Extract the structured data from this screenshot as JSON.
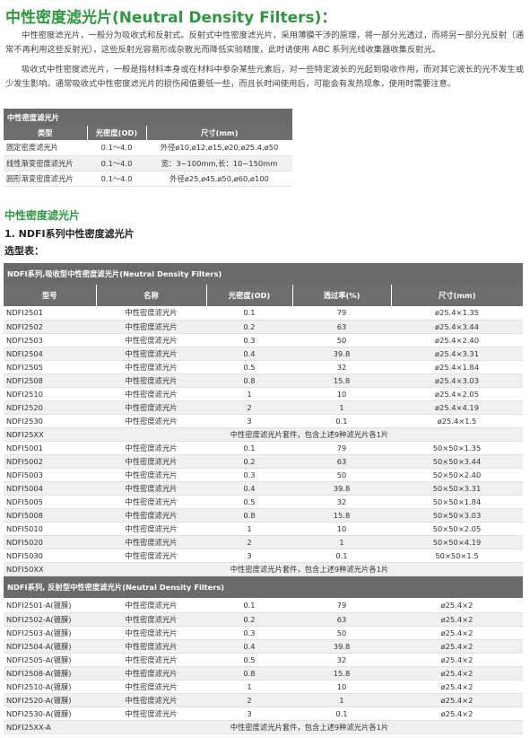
{
  "title": "中性密度滤光片(Neutral Density Filters)：",
  "intro_p1": "中性密度滤光片，一般分为吸收式和反射式。反射式中性密度滤光片，采用薄膜干涉的原理，将一部分光透过，而将另一部分光反射（通常不再利用这些反射光），这些反射光容易形成杂散光而降低实验精度，此时请使用 ABC 系列光线收集器收集反射光。",
  "intro_p2": "吸收式中性密度滤光片，一般是指材料本身或在材料中参杂某些元素后，对一些特定波长的光起到吸收作用，而对其它波长的光不发生或少发生影响。通常吸收式中性密度滤光片的损伤阈值要低一些，而且长时间使用后，可能会有发热现象，使用时需要注意。",
  "summary_table": {
    "caption": "中性密度滤光片",
    "headers": [
      "类型",
      "光密度(OD)",
      "尺寸(mm)"
    ],
    "rows": [
      [
        "固定密度滤光片",
        "0.1～4.0",
        "外径ø10,ø12,ø15,ø20,ø25.4,ø50"
      ],
      [
        "线性渐变密度滤光片",
        "0.1～4.0",
        "宽：3~100mm,长：10~150mm"
      ],
      [
        "圆形渐变密度滤光片",
        "0.1～4.0",
        "外径ø25,ø45,ø50,ø60,ø100"
      ]
    ]
  },
  "section_heading": "中性密度滤光片",
  "sub_heading": "1. NDFI系列中性密度滤光片",
  "selection_label": "选型表：",
  "absorptive_table": {
    "caption": "NDFI系列,吸收型中性密度滤光片(Neutral Density Filters)",
    "headers": [
      "型号",
      "名称",
      "光密度(OD)",
      "透过率(%)",
      "尺寸(mm)"
    ],
    "rows": [
      [
        "NDFI2501",
        "中性密度滤光片",
        "0.1",
        "79",
        "ø25.4×1.35"
      ],
      [
        "NDFI2502",
        "中性密度滤光片",
        "0.2",
        "63",
        "ø25.4×3.44"
      ],
      [
        "NDFI2503",
        "中性密度滤光片",
        "0.3",
        "50",
        "ø25.4×2.40"
      ],
      [
        "NDFI2504",
        "中性密度滤光片",
        "0.4",
        "39.8",
        "ø25.4×3.31"
      ],
      [
        "NDFI2505",
        "中性密度滤光片",
        "0.5",
        "32",
        "ø25.4×1.84"
      ],
      [
        "NDFI2508",
        "中性密度滤光片",
        "0.8",
        "15.8",
        "ø25.4×3.03"
      ],
      [
        "NDFI2510",
        "中性密度滤光片",
        "1",
        "10",
        "ø25.4×2.05"
      ],
      [
        "NDFI2520",
        "中性密度滤光片",
        "2",
        "1",
        "ø25.4×4.19"
      ],
      [
        "NDFI2530",
        "中性密度滤光片",
        "3",
        "0.1",
        "ø25.4×1.5"
      ],
      [
        "NDFI25XX",
        "中性密度滤光片套件，包含上述9种滤光片各1片"
      ],
      [
        "NDFI5001",
        "中性密度滤光片",
        "0.1",
        "79",
        "50×50×1.35"
      ],
      [
        "NDFI5002",
        "中性密度滤光片",
        "0.2",
        "63",
        "50×50×3.44"
      ],
      [
        "NDFI5003",
        "中性密度滤光片",
        "0.3",
        "50",
        "50×50×2.40"
      ],
      [
        "NDFI5004",
        "中性密度滤光片",
        "0.4",
        "39.8",
        "50×50×3.31"
      ],
      [
        "NDFI5005",
        "中性密度滤光片",
        "0.5",
        "32",
        "50×50×1.84"
      ],
      [
        "NDFI5008",
        "中性密度滤光片",
        "0.8",
        "15.8",
        "50×50×3.03"
      ],
      [
        "NDFI5010",
        "中性密度滤光片",
        "1",
        "10",
        "50×50×2.05"
      ],
      [
        "NDFI5020",
        "中性密度滤光片",
        "2",
        "1",
        "50×50×4.19"
      ],
      [
        "NDFI5030",
        "中性密度滤光片",
        "3",
        "0.1",
        "50×50×1.5"
      ],
      [
        "NDFI50XX",
        "中性密度滤光片套件，包含上述9种滤光片各1片"
      ]
    ]
  },
  "reflective_table": {
    "caption": "NDFI系列, 反射型中性密度滤光片(Neutral Density Filters)",
    "rows": [
      [
        "NDFI2501-A(镀膜)",
        "中性密度滤光片",
        "0.1",
        "79",
        "ø25.4×2"
      ],
      [
        "NDFI2502-A(镀膜)",
        "中性密度滤光片",
        "0.2",
        "63",
        "ø25.4×2"
      ],
      [
        "NDFI2503-A(镀膜)",
        "中性密度滤光片",
        "0.3",
        "50",
        "ø25.4×2"
      ],
      [
        "NDFI2504-A(镀膜)",
        "中性密度滤光片",
        "0.4",
        "39.8",
        "ø25.4×2"
      ],
      [
        "NDFI2505-A(镀膜)",
        "中性密度滤光片",
        "0.5",
        "32",
        "ø25.4×2"
      ],
      [
        "NDFI2508-A(镀膜)",
        "中性密度滤光片",
        "0.8",
        "15.8",
        "ø25.4×2"
      ],
      [
        "NDFI2510-A(镀膜)",
        "中性密度滤光片",
        "1",
        "10",
        "ø25.4×2"
      ],
      [
        "NDFI2520-A(镀膜)",
        "中性密度滤光片",
        "2",
        "1",
        "ø25.4×2"
      ],
      [
        "NDFI2530-A(镀膜)",
        "中性密度滤光片",
        "3",
        "0.1",
        "ø25.4×2"
      ],
      [
        "NDFI25XX-A",
        "中性密度滤光片套件，包含上述9种滤光片各1片"
      ]
    ]
  }
}
